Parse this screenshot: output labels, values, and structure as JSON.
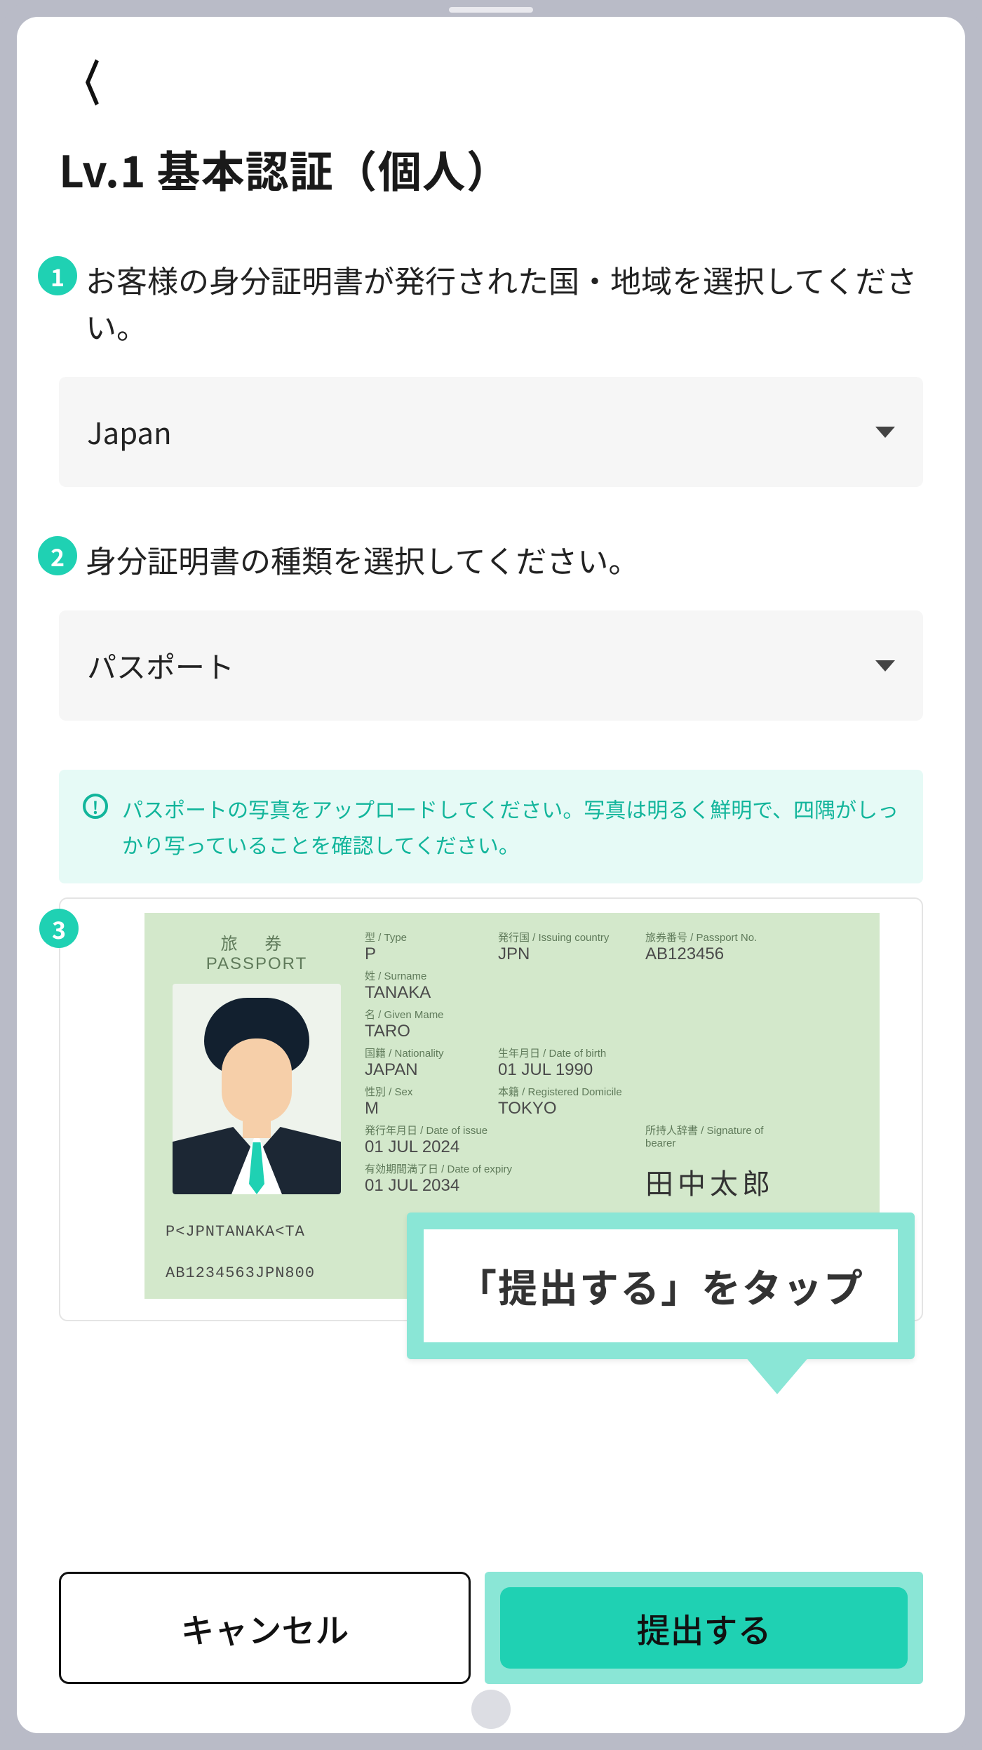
{
  "header": {
    "title": "Lv.1 基本認証（個人）"
  },
  "steps": {
    "s1": {
      "num": "1",
      "text": "お客様の身分証明書が発行された国・地域を選択してください。"
    },
    "s2": {
      "num": "2",
      "text": "身分証明書の種類を選択してください。"
    },
    "s3": {
      "num": "3"
    }
  },
  "selects": {
    "country": "Japan",
    "doc_type": "パスポート"
  },
  "info": "パスポートの写真をアップロードしてください。写真は明るく鮮明で、四隅がしっかり写っていることを確認してください。",
  "passport": {
    "header_jp": "旅 券",
    "header_en": "PASSPORT",
    "type_label": "型 / Type",
    "type": "P",
    "country_label": "発行国 / Issuing country",
    "country": "JPN",
    "number_label": "旅券番号 / Passport No.",
    "number": "AB123456",
    "surname_label": "姓 / Surname",
    "surname": "TANAKA",
    "given_label": "名 / Given Mame",
    "given": "TARO",
    "nat_label": "国籍 / Nationality",
    "nat": "JAPAN",
    "dob_label": "生年月日 / Date of birth",
    "dob": "01 JUL 1990",
    "sex_label": "性別 / Sex",
    "sex": "M",
    "dom_label": "本籍 / Registered Domicile",
    "dom": "TOKYO",
    "issue_label": "発行年月日 / Date of issue",
    "issue": "01 JUL 2024",
    "expiry_label": "有効期間満了日 / Date of expiry",
    "expiry": "01 JUL 2034",
    "sig_label": "所持人辞書 / Signature of bearer",
    "sig": "田中太郎",
    "mrz1": "P<JPNTANAKA<TA",
    "mrz2": "AB1234563JPN800"
  },
  "callout": "「提出する」をタップ",
  "buttons": {
    "cancel": "キャンセル",
    "submit": "提出する"
  }
}
